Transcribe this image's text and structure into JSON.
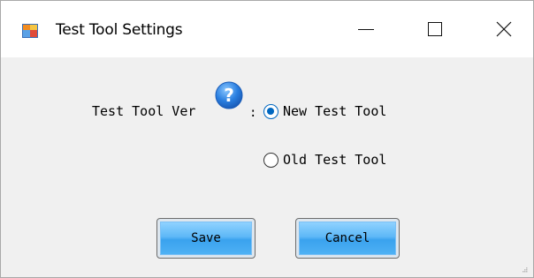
{
  "window": {
    "title": "Test Tool Settings",
    "icons": {
      "app": "app-icon",
      "minimize": "minimize-icon",
      "maximize": "maximize-icon",
      "close": "close-icon"
    }
  },
  "form": {
    "version_label": "Test Tool Ver",
    "version_colon": ":",
    "help_icon": "help-icon",
    "options": [
      {
        "label": "New Test Tool",
        "checked": true
      },
      {
        "label": "Old Test Tool",
        "checked": false
      }
    ]
  },
  "buttons": {
    "save": "Save",
    "cancel": "Cancel"
  },
  "colors": {
    "accent": "#0067c0",
    "button_blue": "#4eb1f4",
    "dialog_bg": "#f0f0f0"
  }
}
